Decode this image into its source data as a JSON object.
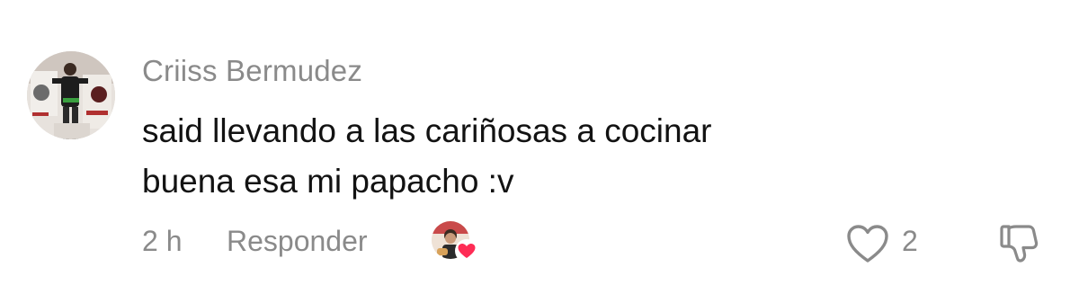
{
  "comment": {
    "username": "Criiss Bermudez",
    "text_lines": [
      "said llevando a las cariñosas a cocinar",
      "buena esa mi papacho :v"
    ],
    "timestamp": "2 h",
    "reply_label": "Responder",
    "like_count": "2",
    "icons": {
      "avatar": "user-avatar",
      "creator_liked": "creator-liked-badge",
      "like": "heart-outline-icon",
      "dislike": "thumbs-down-icon"
    },
    "colors": {
      "primary_text": "#121212",
      "secondary_text": "#8a8a8a",
      "heart_badge": "#fe2c55"
    }
  }
}
